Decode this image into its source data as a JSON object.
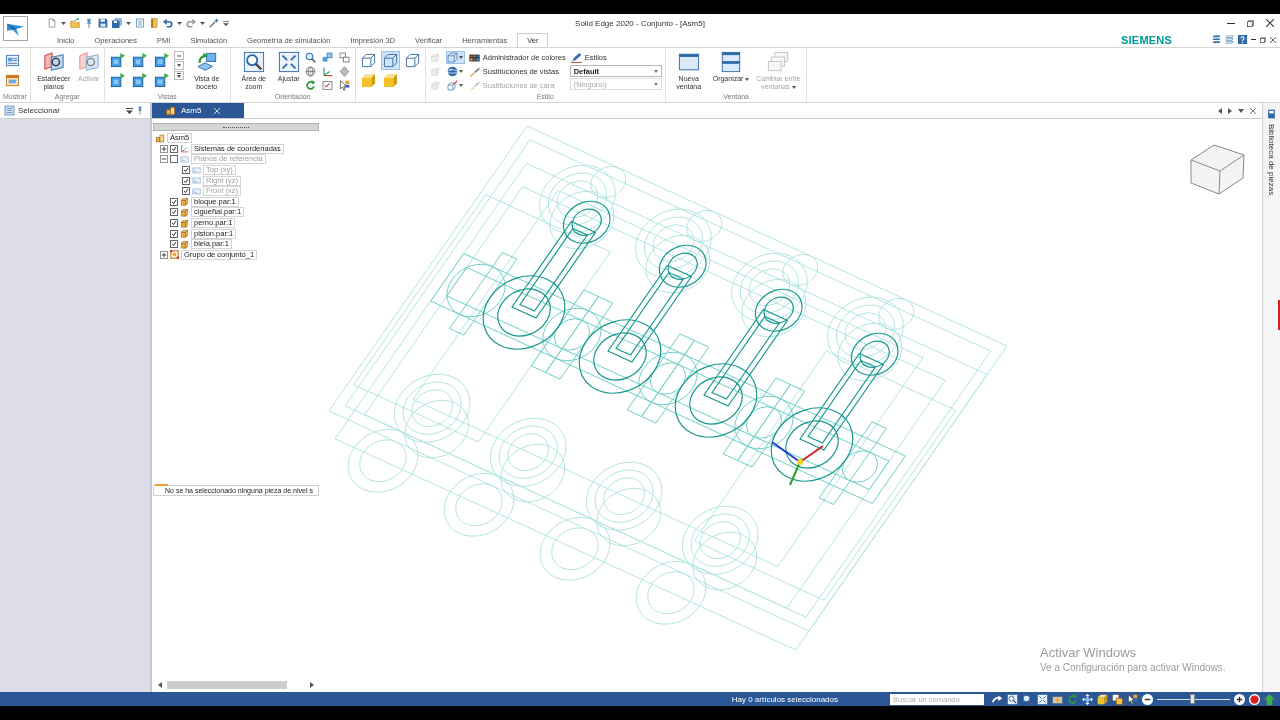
{
  "window": {
    "title": "Solid Edge 2020 - Conjunto - [Asm5]"
  },
  "tabs": [
    {
      "label": "Inicio",
      "selected": false
    },
    {
      "label": "Operaciones",
      "selected": false
    },
    {
      "label": "PMI",
      "selected": false
    },
    {
      "label": "Simulación",
      "selected": false
    },
    {
      "label": "Geometría de simulación",
      "selected": false
    },
    {
      "label": "Impresión 3D",
      "selected": false
    },
    {
      "label": "Verificar",
      "selected": false
    },
    {
      "label": "Herramientas",
      "selected": false
    },
    {
      "label": "Ver",
      "selected": true
    }
  ],
  "brand": "SIEMENS",
  "ribbon": [
    {
      "label": "Mostrar",
      "items": [
        {
          "kind": "tool",
          "selected": false,
          "disabled": false
        },
        {
          "kind": "tool",
          "selected": false,
          "disabled": false
        }
      ]
    },
    {
      "label": "Agregar",
      "items": [
        {
          "kind": "large",
          "label": "Establecer planos",
          "disabled": false
        },
        {
          "kind": "large",
          "label": "Activar",
          "disabled": true
        }
      ]
    },
    {
      "label": "Vistas",
      "items": [
        {
          "kind": "tool",
          "selected": false,
          "disabled": false
        },
        {
          "kind": "tool",
          "selected": false,
          "disabled": false
        },
        {
          "kind": "tool",
          "selected": false,
          "disabled": false
        },
        {
          "kind": "tool",
          "selected": false,
          "disabled": false
        },
        {
          "kind": "tool",
          "selected": false,
          "disabled": false
        },
        {
          "kind": "tool",
          "selected": false,
          "disabled": false
        },
        {
          "kind": "spinner",
          "disabled": false
        },
        {
          "kind": "large",
          "label": "Vista de boceto",
          "disabled": false
        }
      ]
    },
    {
      "label": "Orientación",
      "items": [
        {
          "kind": "large",
          "label": "Área de zoom",
          "disabled": false
        },
        {
          "kind": "large",
          "label": "Ajustar",
          "disabled": false
        },
        {
          "kind": "tool",
          "selected": false,
          "disabled": false
        },
        {
          "kind": "tool",
          "selected": false,
          "disabled": false
        },
        {
          "kind": "tool",
          "selected": false,
          "disabled": false
        },
        {
          "kind": "tool",
          "selected": false,
          "disabled": false
        },
        {
          "kind": "tool",
          "selected": false,
          "disabled": false
        },
        {
          "kind": "tool",
          "selected": false,
          "disabled": false
        },
        {
          "kind": "tool",
          "selected": false,
          "disabled": false
        },
        {
          "kind": "tool",
          "selected": false,
          "disabled": false
        },
        {
          "kind": "tool",
          "selected": false,
          "disabled": false
        }
      ]
    },
    {
      "items": [
        {
          "kind": "tool",
          "selected": false,
          "disabled": false
        },
        {
          "kind": "tool",
          "selected": true,
          "disabled": false
        },
        {
          "kind": "tool",
          "selected": false,
          "disabled": false
        },
        {
          "kind": "tool",
          "selected": false,
          "disabled": false
        },
        {
          "kind": "tool",
          "selected": false,
          "disabled": false
        }
      ]
    },
    {
      "label": "Estilo",
      "items": [
        {
          "kind": "tool",
          "selected": false,
          "disabled": true
        },
        {
          "kind": "tool",
          "selected": false,
          "disabled": true
        },
        {
          "kind": "tool",
          "selected": false,
          "disabled": true
        },
        {
          "kind": "split",
          "selected": true,
          "disabled": false
        },
        {
          "kind": "split",
          "selected": false,
          "disabled": false
        },
        {
          "kind": "split",
          "selected": false,
          "disabled": false
        },
        {
          "kind": "small",
          "label": "Administrador de colores",
          "disabled": false
        },
        {
          "kind": "small",
          "label": "Sustituciones de vistas",
          "disabled": false
        },
        {
          "kind": "small",
          "label": "Sustituciones de cara",
          "disabled": true
        },
        {
          "kind": "small",
          "label": "Estilos",
          "disabled": false
        },
        {
          "kind": "dropdown",
          "value": "Default",
          "disabled": false
        },
        {
          "kind": "dropdown",
          "value": "(Ninguno)",
          "disabled": true
        }
      ]
    },
    {
      "label": "Ventana",
      "items": [
        {
          "kind": "large",
          "label": "Nueva ventana",
          "disabled": false
        },
        {
          "kind": "menu",
          "label": "Organizar",
          "disabled": false
        },
        {
          "kind": "menu",
          "label": "Cambiar entre ventanas",
          "disabled": true
        }
      ]
    }
  ],
  "selection_panel": {
    "title": "Seleccionar"
  },
  "document_tabs": [
    {
      "label": "Asm5",
      "selected": true
    }
  ],
  "tree": [
    {
      "label": "Asm5",
      "kind": "assembly",
      "dimmed": false,
      "children": [
        {
          "label": "Sistemas de coordenadas",
          "kind": "coordinates",
          "expanded": false,
          "checked": true,
          "dimmed": false
        },
        {
          "label": "Planos de referencia",
          "kind": "planes",
          "expanded": true,
          "checked": false,
          "dimmed": true,
          "children": [
            {
              "label": "Top (xy)",
              "kind": "plane",
              "checked": true,
              "dimmed": true
            },
            {
              "label": "Right (yz)",
              "kind": "plane",
              "checked": true,
              "dimmed": true
            },
            {
              "label": "Front (xz)",
              "kind": "plane",
              "checked": true,
              "dimmed": true
            }
          ]
        },
        {
          "label": "bloque.par:1",
          "kind": "part",
          "checked": true,
          "dimmed": false
        },
        {
          "label": "cigueñal.par:1",
          "kind": "part",
          "checked": true,
          "dimmed": false
        },
        {
          "label": "perno.par:1",
          "kind": "part",
          "checked": true,
          "dimmed": false
        },
        {
          "label": "piston.par:1",
          "kind": "part",
          "checked": true,
          "dimmed": false
        },
        {
          "label": "biela.par:1",
          "kind": "part",
          "checked": true,
          "dimmed": false
        },
        {
          "label": "Grupo de conjunto_1",
          "kind": "group",
          "expanded": false,
          "dimmed": false
        }
      ]
    }
  ],
  "tree_message": "No se ha seleccionado ninguna pieza de nivel s",
  "library_panel": {
    "title": "Biblioteca de piezas"
  },
  "windows_notice": {
    "title": "Activar Windows",
    "text": "Ve a Configuración para activar Windows."
  },
  "status_bar": {
    "text": "Hay 0 artículos seleccionados",
    "search": {
      "placeholder": "Buscar un comando"
    },
    "zoom": {
      "level": 0.49
    }
  }
}
